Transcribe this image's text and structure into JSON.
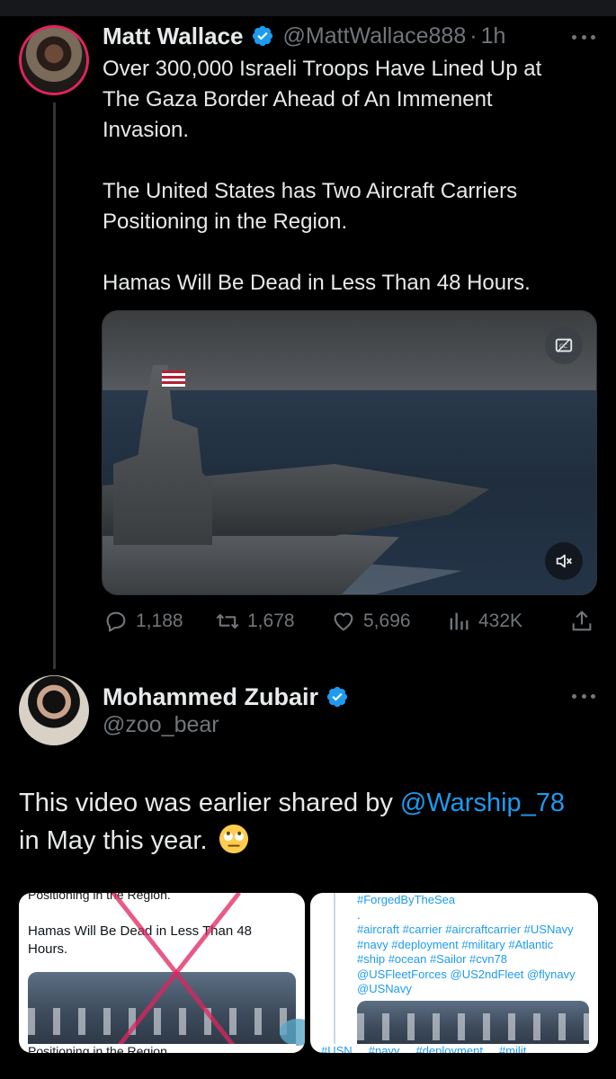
{
  "tweet": {
    "author_name": "Matt Wallace",
    "handle": "@MattWallace888",
    "separator": "·",
    "time": "1h",
    "text_lines": [
      "Over 300,000 Israeli Troops Have Lined Up at",
      "The Gaza Border Ahead of An Immenent",
      "Invasion.",
      "",
      "The United States has Two Aircraft Carriers",
      "Positioning in the Region.",
      "",
      "Hamas Will Be Dead in Less Than 48 Hours."
    ],
    "stats": {
      "replies": "1,188",
      "reposts": "1,678",
      "likes": "5,696",
      "views": "432K"
    }
  },
  "reply": {
    "author_name": "Mohammed Zubair",
    "handle": "@zoo_bear",
    "text_before": "This video was earlier shared by ",
    "mention": "@Warship_78",
    "text_line2": "in May this year.",
    "emoji_icon": "eye-roll-emoji"
  },
  "screenshots": {
    "left": {
      "cut_top": "Positioning in the Region.",
      "body": "Hamas Will Be Dead in Less Than 48 Hours.",
      "cut_bottom": "Positioning in the Region."
    },
    "right": {
      "tag_line1": "#ForgedByTheSea",
      "tag_dot": ".",
      "tag_line2": "#aircraft #carrier #aircraftcarrier #USNavy",
      "tag_line3": "#navy #deployment #military #Atlantic",
      "tag_line4": "#ship #ocean #Sailor #cvn78",
      "tag_line5": "@USFleetForces @US2ndFleet @flynavy",
      "tag_line6": "@USNavy",
      "cut_bottom": "#USN ... #navy ... #deployment ... #milit"
    }
  },
  "colors": {
    "background": "#000000",
    "text": "#e7e9ea",
    "secondary": "#71767b",
    "accent": "#1d9bf0",
    "cross": "#e0245e"
  }
}
